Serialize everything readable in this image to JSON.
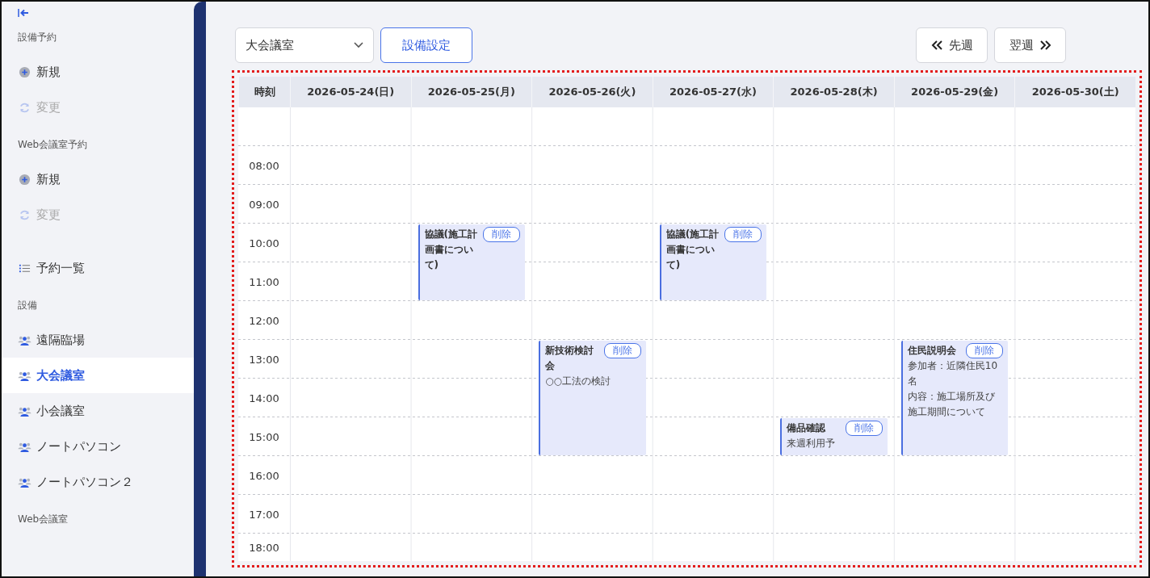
{
  "sidebar": {
    "sections": [
      {
        "heading": "設備予約",
        "items": [
          {
            "label": "新規",
            "kind": "plus",
            "disabled": false,
            "selected": false
          },
          {
            "label": "変更",
            "kind": "refresh",
            "disabled": true,
            "selected": false
          }
        ]
      },
      {
        "heading": "Web会議室予約",
        "items": [
          {
            "label": "新規",
            "kind": "plus",
            "disabled": false,
            "selected": false
          },
          {
            "label": "変更",
            "kind": "refresh",
            "disabled": true,
            "selected": false
          }
        ]
      },
      {
        "items": [
          {
            "label": "予約一覧",
            "kind": "list",
            "disabled": false,
            "selected": false
          }
        ]
      },
      {
        "heading": "設備",
        "items": [
          {
            "label": "遠隔臨場",
            "kind": "people",
            "disabled": false,
            "selected": false
          },
          {
            "label": "大会議室",
            "kind": "people",
            "disabled": false,
            "selected": true
          },
          {
            "label": "小会議室",
            "kind": "people",
            "disabled": false,
            "selected": false
          },
          {
            "label": "ノートパソコン",
            "kind": "people",
            "disabled": false,
            "selected": false
          },
          {
            "label": "ノートパソコン２",
            "kind": "people",
            "disabled": false,
            "selected": false
          }
        ]
      },
      {
        "heading": "Web会議室"
      }
    ]
  },
  "toolbar": {
    "facility_select": {
      "value": "大会議室"
    },
    "settings_button": "設備設定",
    "prev_button": "先週",
    "next_button": "翌週"
  },
  "calendar": {
    "time_header": "時刻",
    "days": [
      "2026-05-24(日)",
      "2026-05-25(月)",
      "2026-05-26(火)",
      "2026-05-27(水)",
      "2026-05-28(木)",
      "2026-05-29(金)",
      "2026-05-30(土)"
    ],
    "rows": [
      {
        "cells": [
          {
            "kind": "free"
          },
          {
            "kind": "free"
          },
          {
            "kind": "free"
          },
          {
            "kind": "free"
          },
          {
            "kind": "free"
          },
          {
            "kind": "free"
          },
          {
            "kind": "free"
          }
        ]
      },
      {
        "time": "08:00",
        "cells": [
          {
            "kind": "free"
          },
          {
            "kind": "free"
          },
          {
            "kind": "free"
          },
          {
            "kind": "free"
          },
          {
            "kind": "free"
          },
          {
            "kind": "free"
          },
          {
            "kind": "free"
          }
        ]
      },
      {
        "time": "09:00",
        "cells": [
          {
            "kind": "free"
          },
          {
            "kind": "free"
          },
          {
            "kind": "free"
          },
          {
            "kind": "free"
          },
          {
            "kind": "free"
          },
          {
            "kind": "free"
          },
          {
            "kind": "free"
          }
        ]
      },
      {
        "time": "10:00",
        "cells": [
          {
            "kind": "free"
          },
          {
            "kind": "event",
            "title": "協議(施工計画書について)",
            "delete_button": "削除"
          },
          {
            "kind": "free"
          },
          {
            "kind": "event",
            "title": "協議(施工計画書について)",
            "delete_button": "削除"
          },
          {
            "kind": "free"
          },
          {
            "kind": "free"
          },
          {
            "kind": "free"
          }
        ]
      },
      {
        "time": "11:00",
        "cells": [
          {
            "kind": "free"
          },
          {
            "kind": "continued"
          },
          {
            "kind": "free"
          },
          {
            "kind": "continued"
          },
          {
            "kind": "free"
          },
          {
            "kind": "free"
          },
          {
            "kind": "free"
          }
        ]
      },
      {
        "time": "12:00",
        "cells": [
          {
            "kind": "free"
          },
          {
            "kind": "free"
          },
          {
            "kind": "free"
          },
          {
            "kind": "free"
          },
          {
            "kind": "free"
          },
          {
            "kind": "free"
          },
          {
            "kind": "free"
          }
        ]
      },
      {
        "time": "13:00",
        "cells": [
          {
            "kind": "free"
          },
          {
            "kind": "free"
          },
          {
            "kind": "event",
            "title": "新技術検討会",
            "delete_button": "削除",
            "details": [
              "○○工法の検討"
            ]
          },
          {
            "kind": "free"
          },
          {
            "kind": "free"
          },
          {
            "kind": "event",
            "title": "住民説明会",
            "delete_button": "削除",
            "details": [
              "参加者：近隣住民10名",
              "内容：施工場所及び施工期間について"
            ]
          },
          {
            "kind": "free"
          }
        ]
      },
      {
        "time": "14:00",
        "cells": [
          {
            "kind": "free"
          },
          {
            "kind": "free"
          },
          {
            "kind": "continued"
          },
          {
            "kind": "free"
          },
          {
            "kind": "free"
          },
          {
            "kind": "continued"
          },
          {
            "kind": "free"
          }
        ]
      },
      {
        "time": "15:00",
        "cells": [
          {
            "kind": "free"
          },
          {
            "kind": "free"
          },
          {
            "kind": "continued"
          },
          {
            "kind": "free"
          },
          {
            "kind": "event",
            "title": "備品確認",
            "delete_button": "削除",
            "details": [
              "来週利用予"
            ]
          },
          {
            "kind": "continued"
          },
          {
            "kind": "free"
          }
        ]
      },
      {
        "time": "16:00",
        "cells": [
          {
            "kind": "free"
          },
          {
            "kind": "free"
          },
          {
            "kind": "free"
          },
          {
            "kind": "free"
          },
          {
            "kind": "free"
          },
          {
            "kind": "free"
          },
          {
            "kind": "free"
          }
        ]
      },
      {
        "time": "17:00",
        "cells": [
          {
            "kind": "free"
          },
          {
            "kind": "free"
          },
          {
            "kind": "free"
          },
          {
            "kind": "free"
          },
          {
            "kind": "free"
          },
          {
            "kind": "free"
          },
          {
            "kind": "free"
          }
        ]
      },
      {
        "time": "18:00",
        "cells": [
          {
            "kind": "free"
          },
          {
            "kind": "free"
          },
          {
            "kind": "free"
          },
          {
            "kind": "free"
          },
          {
            "kind": "free"
          },
          {
            "kind": "free"
          },
          {
            "kind": "free"
          }
        ]
      }
    ]
  }
}
